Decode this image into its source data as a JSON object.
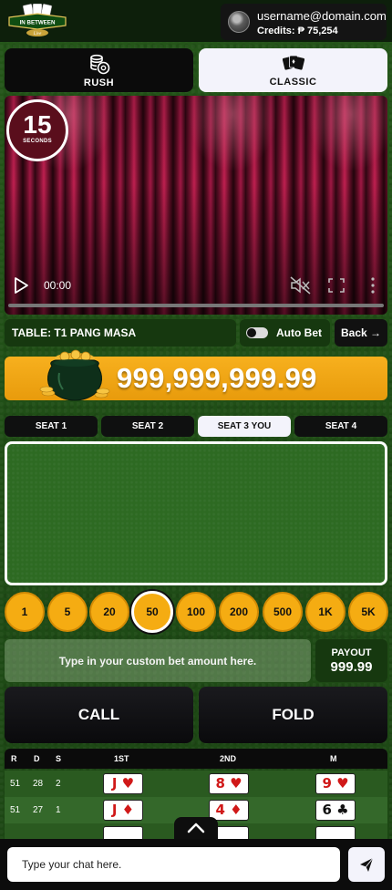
{
  "header": {
    "logo_text": "IN BETWEEN",
    "username": "username@domain.com",
    "credits_label": "Credits: ₱ 75,254"
  },
  "modes": [
    {
      "label": "RUSH",
      "icon": "chip-stack-icon",
      "selected": false
    },
    {
      "label": "CLASSIC",
      "icon": "cards-icon",
      "selected": true
    }
  ],
  "video": {
    "timer_value": "15",
    "timer_unit": "SECONDS",
    "time": "00:00",
    "progress": 0
  },
  "table": {
    "label": "TABLE: T1 PANG MASA",
    "autobet_label": "Auto Bet",
    "autobet_on": false,
    "back_label": "Back →"
  },
  "jackpot": {
    "amount": "999,999,999.99"
  },
  "seats": [
    {
      "label": "SEAT 1",
      "active": false
    },
    {
      "label": "SEAT 2",
      "active": false
    },
    {
      "label": "SEAT 3 YOU",
      "active": true
    },
    {
      "label": "SEAT 4",
      "active": false
    }
  ],
  "chips": [
    "1",
    "5",
    "20",
    "50",
    "100",
    "200",
    "500",
    "1K",
    "5K"
  ],
  "selected_chip": "50",
  "bet": {
    "placeholder": "Type in your custom bet amount here.",
    "payout_label": "PAYOUT",
    "payout_value": "999.99"
  },
  "actions": {
    "call_label": "CALL",
    "fold_label": "FOLD"
  },
  "history": {
    "columns": [
      "R",
      "D",
      "S",
      "1ST",
      "2ND",
      "M"
    ],
    "rows": [
      {
        "r": "51",
        "d": "28",
        "s": "2",
        "first": "J ♥",
        "second": "8 ♥",
        "m": "9 ♥"
      },
      {
        "r": "51",
        "d": "27",
        "s": "1",
        "first": "J ♦",
        "second": "4 ♦",
        "m": "6 ♣"
      }
    ]
  },
  "chat": {
    "placeholder": "Type your chat here."
  },
  "colors": {
    "accent_orange": "#f5ac12",
    "felt_green": "#2d6a22",
    "card_red": "#d01818"
  }
}
